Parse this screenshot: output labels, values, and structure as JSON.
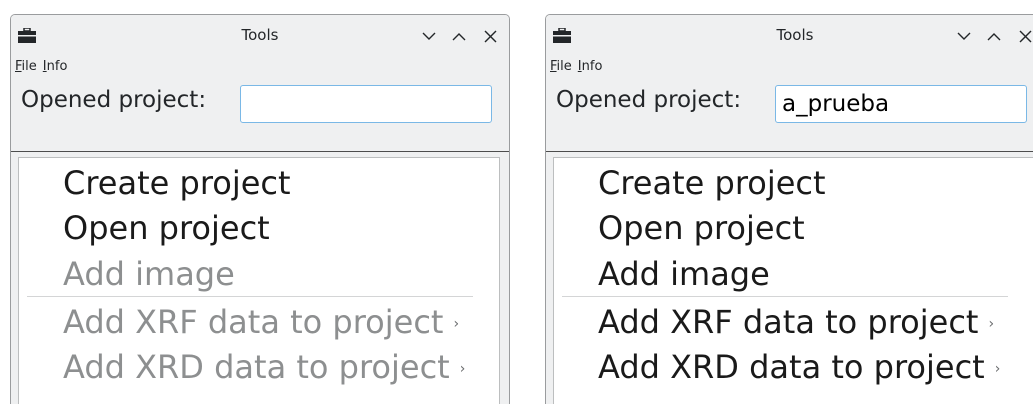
{
  "windows": [
    {
      "title": "Tools",
      "menu": {
        "file_underline": "F",
        "file_rest": "ile",
        "info_underline": "I",
        "info_rest": "nfo"
      },
      "project_label": "Opened project:",
      "project_value": "",
      "actions": [
        {
          "label": "Create project",
          "enabled": true
        },
        {
          "label": "Open project",
          "enabled": true
        },
        {
          "label": "Add image",
          "enabled": false
        },
        {
          "label": "Add XRF data to project",
          "enabled": false,
          "submenu": true
        },
        {
          "label": "Add XRD data to project",
          "enabled": false,
          "submenu": true
        }
      ]
    },
    {
      "title": "Tools",
      "menu": {
        "file_underline": "F",
        "file_rest": "ile",
        "info_underline": "I",
        "info_rest": "nfo"
      },
      "project_label": "Opened project:",
      "project_value": "a_prueba",
      "actions": [
        {
          "label": "Create project",
          "enabled": true
        },
        {
          "label": "Open project",
          "enabled": true
        },
        {
          "label": "Add image",
          "enabled": true
        },
        {
          "label": "Add XRF data to project",
          "enabled": true,
          "submenu": true
        },
        {
          "label": "Add XRD data to project",
          "enabled": true,
          "submenu": true
        }
      ]
    }
  ],
  "icons": {
    "app": "toolbox-icon",
    "minimize": "chevron-down-icon",
    "maximize": "chevron-up-icon",
    "close": "close-icon",
    "submenu": "chevron-right-icon"
  },
  "colors": {
    "window_bg": "#eff0f1",
    "input_focus_border": "#7ab8e6",
    "text": "#232629",
    "disabled_text": "#8d8f90"
  }
}
